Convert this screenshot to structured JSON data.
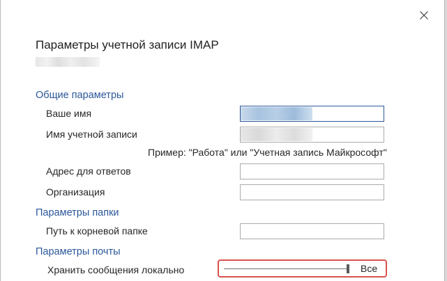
{
  "dialog": {
    "title": "Параметры учетной записи IMAP"
  },
  "sections": {
    "general": "Общие параметры",
    "folder": "Параметры папки",
    "mail": "Параметры почты"
  },
  "fields": {
    "your_name_label": "Ваше имя",
    "account_name_label": "Имя учетной записи",
    "account_name_hint": "Пример: \"Работа\" или \"Учетная запись Майкрософт\"",
    "reply_address_label": "Адрес для ответов",
    "reply_address_value": "",
    "organization_label": "Организация",
    "organization_value": "",
    "root_folder_label": "Путь к корневой папке",
    "root_folder_value": "",
    "keep_mail_label": "Хранить сообщения локально",
    "keep_mail_value": "Все",
    "keep_mail_level": 1.0
  },
  "colors": {
    "section_title": "#2b579a",
    "highlight_border": "#d9534f",
    "focused_border": "#2b579a"
  },
  "icons": {
    "close": "close-icon"
  }
}
